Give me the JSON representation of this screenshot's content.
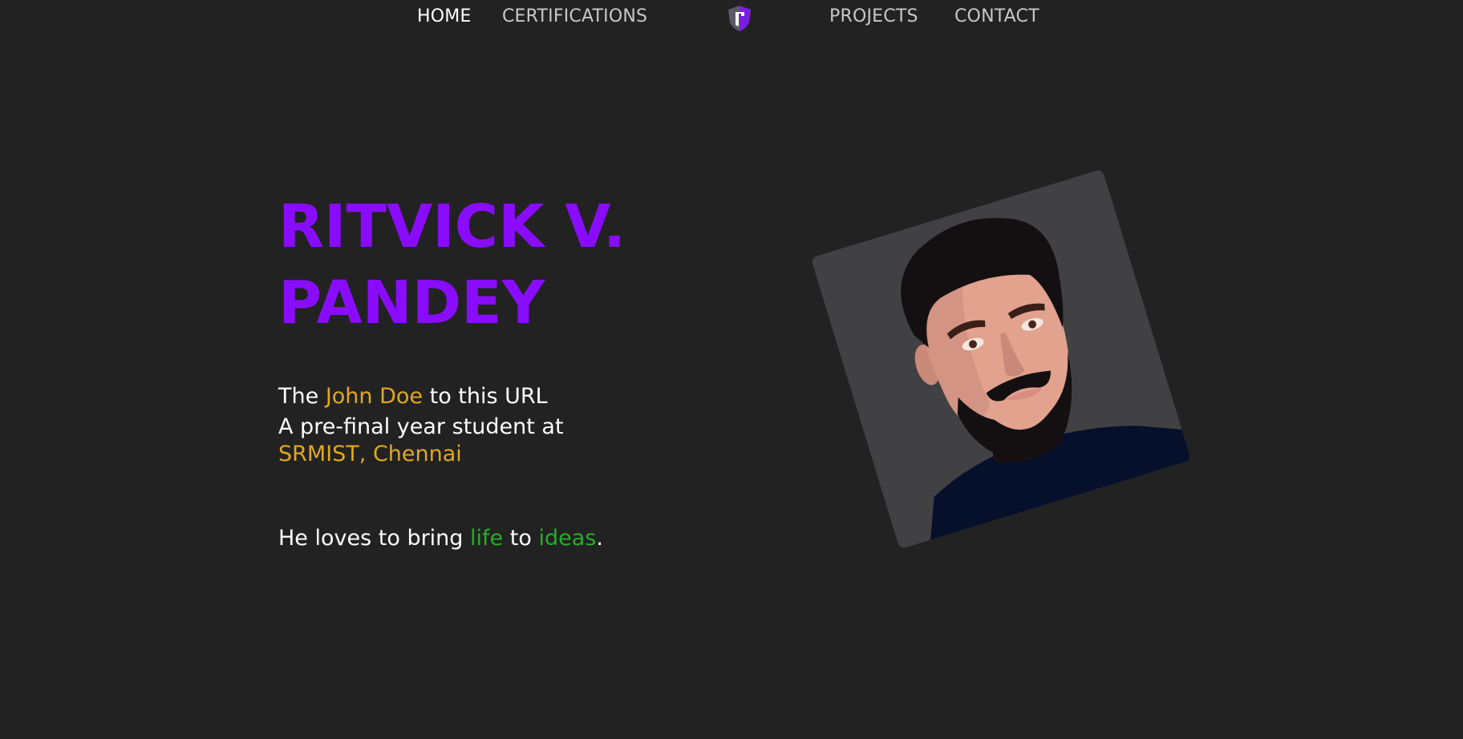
{
  "nav": {
    "home": "HOME",
    "certifications": "CERTIFICATIONS",
    "projects": "PROJECTS",
    "contact": "CONTACT",
    "logo_icon": "shield-logo-icon"
  },
  "hero": {
    "name_line1": "RITVICK V.",
    "name_line2": "PANDEY",
    "intro_the": "The ",
    "intro_highlight": "John Doe",
    "intro_rest": " to this URL",
    "student_text": "A pre-final year student at",
    "institution": "SRMIST, Chennai",
    "tagline_start": "He loves to bring ",
    "tagline_word1": "life",
    "tagline_mid": " to ",
    "tagline_word2": "ideas",
    "tagline_end": "."
  },
  "avatar": {
    "icon": "portrait-illustration"
  },
  "colors": {
    "background": "#222222",
    "accent_purple": "#8a0cff",
    "gold": "#e0a820",
    "green": "#22b022",
    "card": "#414143"
  }
}
